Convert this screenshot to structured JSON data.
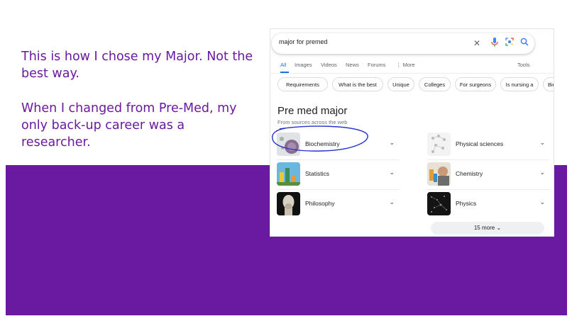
{
  "slide": {
    "caption_lines": [
      "This is how I chose my Major. Not the best way.",
      "When I changed from Pre-Med, my only back-up career was a researcher."
    ]
  },
  "search": {
    "query": "major for premed",
    "icons": [
      "close-icon",
      "mic-icon",
      "lens-icon",
      "search-icon"
    ]
  },
  "tabs": [
    "All",
    "Images",
    "Videos",
    "News",
    "Forums",
    "⋮ More",
    "Tools"
  ],
  "active_tab": "All",
  "chips": [
    "Requirements",
    "What is the best",
    "Unique",
    "Colleges",
    "For surgeons",
    "Is nursing a",
    "Biolo"
  ],
  "result": {
    "heading": "Pre med major",
    "subheading": "From sources across the web",
    "items": [
      "Biochemistry",
      "Physical sciences",
      "Statistics",
      "Chemistry",
      "Philosophy",
      "Physics"
    ],
    "more_label": "15 more",
    "chevron": "⌄"
  },
  "colors": {
    "purple": "#6a1aa0",
    "google_blue": "#1a73e8",
    "annotation": "#2533c8"
  }
}
